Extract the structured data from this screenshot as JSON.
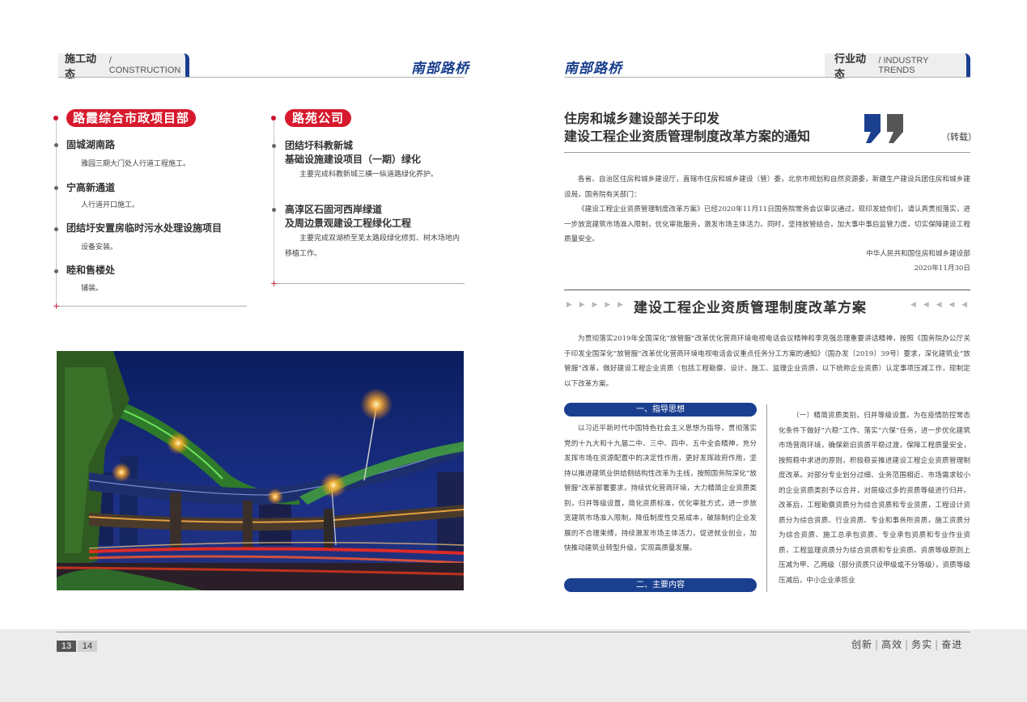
{
  "left_page": {
    "section": {
      "zh": "施工动态",
      "en": "/ CONSTRUCTION"
    },
    "brand": "南部路桥",
    "groups": [
      {
        "tag": "路霞综合市政项目部",
        "items": [
          {
            "title": "固城湖南路",
            "desc": "雅园三期大门处人行道工程施工。"
          },
          {
            "title": "宁高新通道",
            "desc": "人行道开口施工。"
          },
          {
            "title": "团结圩安置房临时污水处理设施项目",
            "desc": "设备安装。"
          },
          {
            "title": "睦和售楼处",
            "desc": "铺装。"
          }
        ]
      },
      {
        "tag": "路苑公司",
        "items": [
          {
            "title": "团结圩科教新城\n基础设施建设项目（一期）绿化",
            "desc": "主要完成科教新城三横一纵道路绿化养护。"
          },
          {
            "title": "高淳区石固河西岸绿道\n及周边景观建设工程绿化工程",
            "desc": "主要完成双湖桥至芜太路段绿化修剪、树木场地内移植工作。"
          }
        ]
      }
    ]
  },
  "right_page": {
    "brand": "南部路桥",
    "section": {
      "zh": "行业动态",
      "en": "/ INDUSTRY TRENDS"
    },
    "notice": {
      "title_line1": "住房和城乡建设部关于印发",
      "title_line2": "建设工程企业资质管理制度改革方案的通知",
      "reprint": "（转载）",
      "para1": "各省、自治区住房和城乡建设厅，直辖市住房和城乡建设（管）委，北京市规划和自然资源委，新疆生产建设兵团住房和城乡建设局，国务院有关部门：",
      "para2": "《建设工程企业资质管理制度改革方案》已经2020年11月11日国务院常务会议审议通过，现印发给你们，请认真贯彻落实，进一步放宽建筑市场准入限制，优化审批服务，激发市场主体活力。同时，坚持放管结合，加大事中事后监管力度，切实保障建设工程质量安全。",
      "signature": "中华人民共和国住房和城乡建设部",
      "date": "2020年11月30日"
    },
    "plan": {
      "title": "建设工程企业资质管理制度改革方案",
      "arrows_left": "▶ ▶ ▶ ▶ ▶",
      "arrows_right": "◀ ◀ ◀ ◀ ◀",
      "intro": "为贯彻落实2019年全国深化“放管服”改革优化营商环境电视电话会议精神和李克强总理重要讲话精神，按照《国务院办公厅关于印发全国深化“放管服”改革优化营商环境电视电话会议重点任务分工方案的通知》（国办发〔2019〕39号）要求，深化建筑业“放管服”改革，做好建设工程企业资质（包括工程勘察、设计、施工、监理企业资质，以下统称企业资质）认定事项压减工作，现制定以下改革方案。",
      "section1_label": "一、指导思想",
      "section1_text": "以习近平新时代中国特色社会主义思想为指导，贯彻落实党的十九大和十九届二中、三中、四中、五中全会精神，充分发挥市场在资源配置中的决定性作用，更好发挥政府作用，坚持以推进建筑业供给侧结构性改革为主线，按照国务院深化“放管服”改革部署要求，持续优化营商环境，大力精简企业资质类别，归并等级设置，简化资质标准，优化审批方式，进一步放宽建筑市场准入限制，降低制度性交易成本，破除制约企业发展的不合理束缚，持续激发市场主体活力，促进就业创业，加快推动建筑业转型升级，实现高质量发展。",
      "section2_label": "二、主要内容",
      "right_col_text": "（一）精简资质类别，归并等级设置。为在疫情防控常态化条件下做好“六稳”工作、落实“六保”任务，进一步优化建筑市场营商环境，确保新旧资质平稳过渡，保障工程质量安全，按照稳中求进的原则，积极稳妥推进建设工程企业资质管理制度改革。对部分专业划分过细、业务范围相近、市场需求较小的企业资质类别予以合并，对层级过多的资质等级进行归并。改革后，工程勘察资质分为综合资质和专业资质，工程设计资质分为综合资质、行业资质、专业和事务所资质，施工资质分为综合资质、施工总承包资质、专业承包资质和专业作业资质，工程监理资质分为综合资质和专业资质。资质等级原则上压减为甲、乙两级（部分资质只设甲级或不分等级），资质等级压减后，中小企业承揽业"
    }
  },
  "footer": {
    "page_left": "13",
    "page_right": "14",
    "slogan": [
      "创新",
      "高效",
      "务实",
      "奋进"
    ]
  },
  "colors": {
    "brand_blue": "#1a3f8f",
    "tag_red": "#d7192d"
  }
}
